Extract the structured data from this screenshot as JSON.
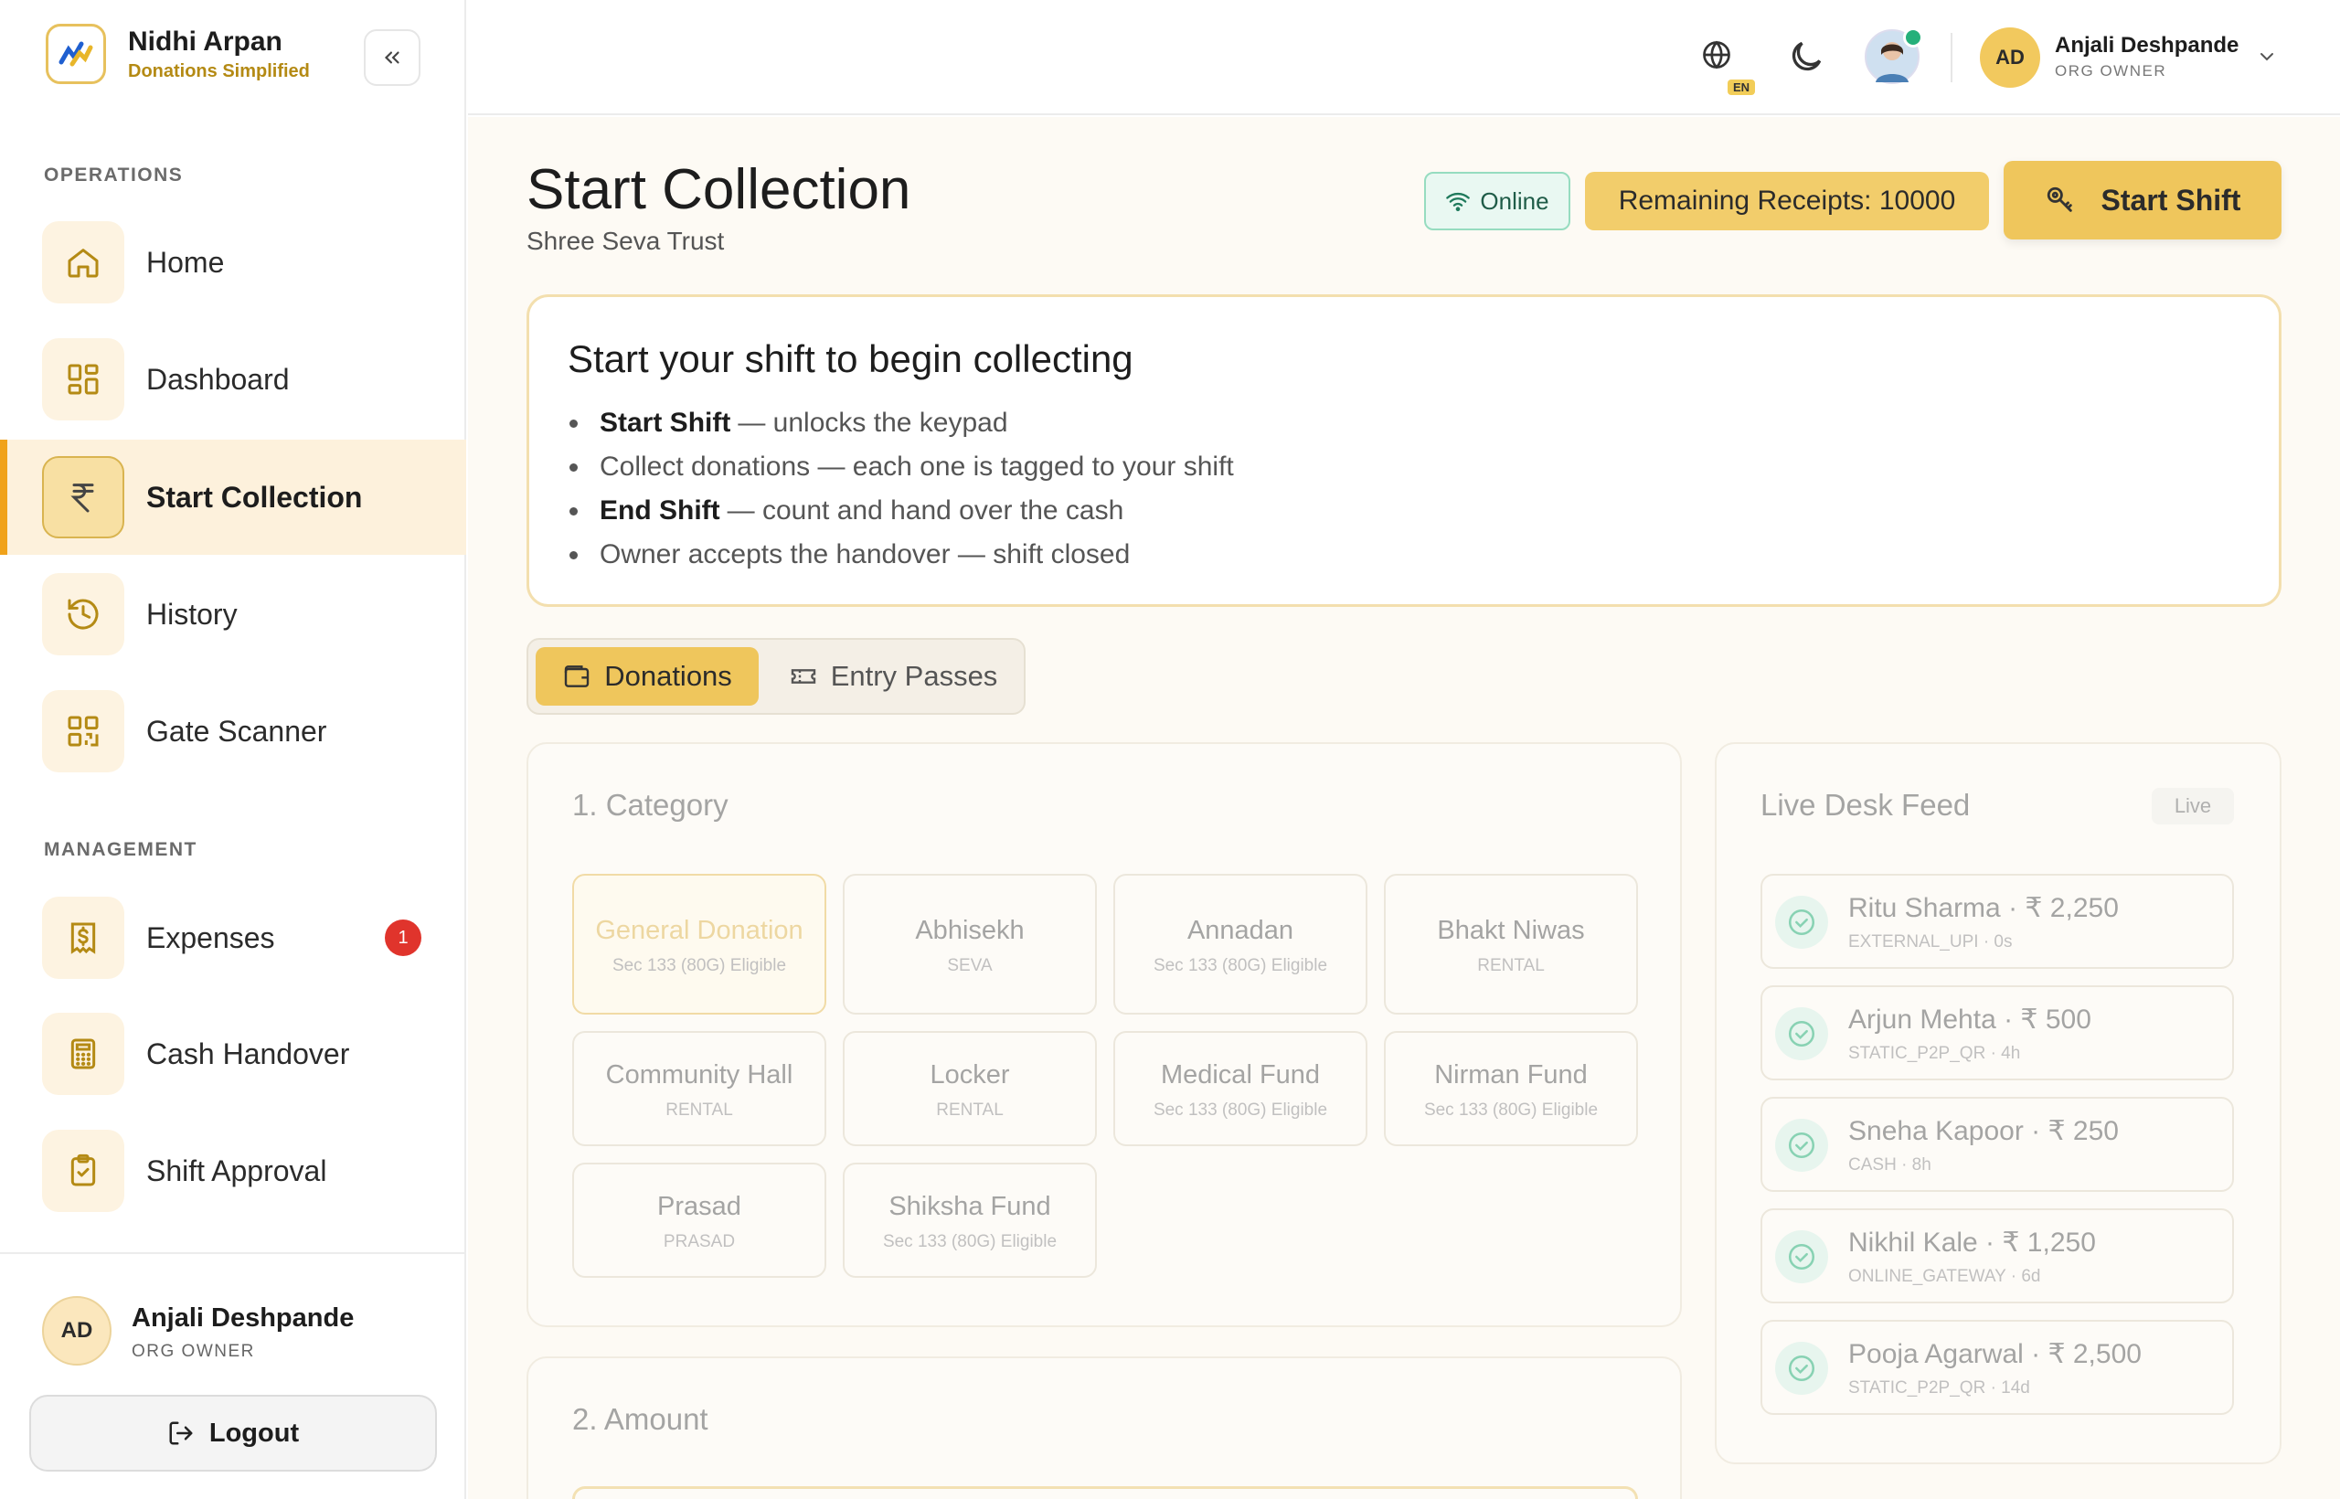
{
  "brand": {
    "name": "Nidhi Arpan",
    "tagline": "Donations Simplified"
  },
  "sidebar": {
    "operations_title": "OPERATIONS",
    "management_title": "MANAGEMENT",
    "items": [
      {
        "label": "Home",
        "icon": "home-icon"
      },
      {
        "label": "Dashboard",
        "icon": "dashboard-icon"
      },
      {
        "label": "Start Collection",
        "icon": "rupee-icon",
        "active": true
      },
      {
        "label": "History",
        "icon": "history-icon"
      },
      {
        "label": "Gate Scanner",
        "icon": "qr-icon"
      },
      {
        "label": "Expenses",
        "icon": "expense-icon",
        "badge": "1"
      },
      {
        "label": "Cash Handover",
        "icon": "calculator-icon"
      },
      {
        "label": "Shift Approval",
        "icon": "clipboard-check-icon"
      }
    ],
    "user": {
      "initials": "AD",
      "name": "Anjali Deshpande",
      "role": "ORG OWNER"
    },
    "logout_label": "Logout"
  },
  "topbar": {
    "lang": "EN",
    "user": {
      "initials": "AD",
      "name": "Anjali Deshpande",
      "role": "ORG OWNER"
    }
  },
  "page": {
    "title": "Start Collection",
    "subtitle": "Shree Seva Trust",
    "online_label": "Online",
    "remaining_label": "Remaining Receipts:",
    "remaining_value": "10000",
    "start_shift_label": "Start Shift"
  },
  "info": {
    "title": "Start your shift to begin collecting",
    "steps": [
      {
        "bold": "Start Shift",
        "text": "— unlocks the keypad"
      },
      {
        "bold": "",
        "text": "Collect donations — each one is tagged to your shift"
      },
      {
        "bold": "End Shift",
        "text": "— count and hand over the cash"
      },
      {
        "bold": "",
        "text": "Owner accepts the handover — shift closed"
      }
    ]
  },
  "tabs": [
    {
      "label": "Donations",
      "active": true
    },
    {
      "label": "Entry Passes",
      "active": false
    }
  ],
  "category": {
    "title": "1. Category",
    "items": [
      {
        "name": "General Donation",
        "sub": "Sec 133 (80G) Eligible",
        "selected": true
      },
      {
        "name": "Abhisekh",
        "sub": "SEVA"
      },
      {
        "name": "Annadan",
        "sub": "Sec 133 (80G) Eligible"
      },
      {
        "name": "Bhakt Niwas",
        "sub": "RENTAL"
      },
      {
        "name": "Community Hall",
        "sub": "RENTAL"
      },
      {
        "name": "Locker",
        "sub": "RENTAL"
      },
      {
        "name": "Medical Fund",
        "sub": "Sec 133 (80G) Eligible"
      },
      {
        "name": "Nirman Fund",
        "sub": "Sec 133 (80G) Eligible"
      },
      {
        "name": "Prasad",
        "sub": "PRASAD"
      },
      {
        "name": "Shiksha Fund",
        "sub": "Sec 133 (80G) Eligible"
      }
    ]
  },
  "amount": {
    "title": "2. Amount"
  },
  "feed": {
    "title": "Live Desk Feed",
    "live_label": "Live",
    "items": [
      {
        "title": "Ritu Sharma · ₹ 2,250",
        "meta": "EXTERNAL_UPI · 0s"
      },
      {
        "title": "Arjun Mehta · ₹ 500",
        "meta": "STATIC_P2P_QR · 4h"
      },
      {
        "title": "Sneha Kapoor · ₹ 250",
        "meta": "CASH · 8h"
      },
      {
        "title": "Nikhil Kale · ₹ 1,250",
        "meta": "ONLINE_GATEWAY · 6d"
      },
      {
        "title": "Pooja Agarwal · ₹ 2,500",
        "meta": "STATIC_P2P_QR · 14d"
      }
    ]
  },
  "colors": {
    "accent": "#efc65c",
    "active_bar": "#f0a21a",
    "online": "#25b07a",
    "badge": "#e0342c"
  }
}
